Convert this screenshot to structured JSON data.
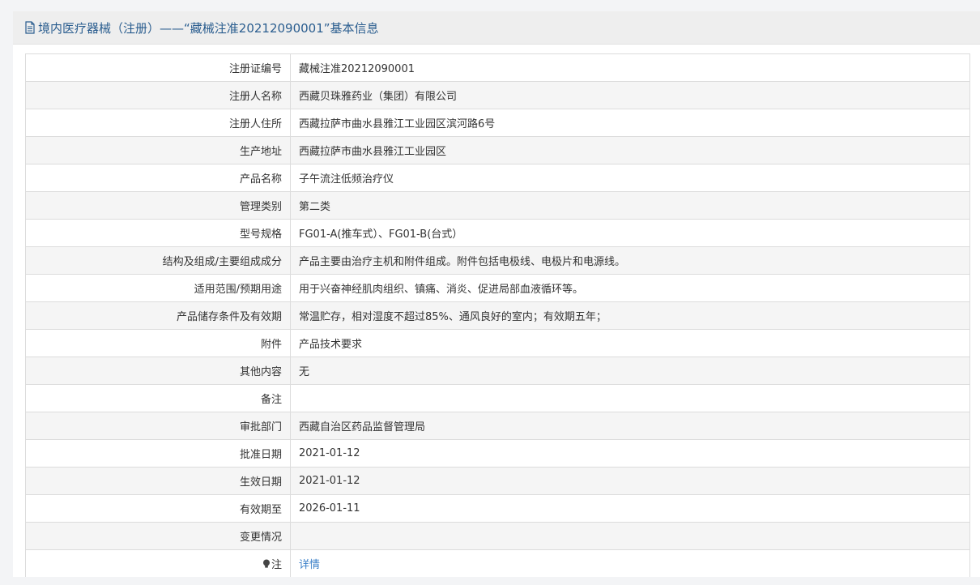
{
  "header": {
    "title": "境内医疗器械（注册）——“藏械注准20212090001”基本信息"
  },
  "rows": [
    {
      "label": "注册证编号",
      "value": "藏械注准20212090001"
    },
    {
      "label": "注册人名称",
      "value": "西藏贝珠雅药业（集团）有限公司"
    },
    {
      "label": "注册人住所",
      "value": "西藏拉萨市曲水县雅江工业园区滨河路6号"
    },
    {
      "label": "生产地址",
      "value": "西藏拉萨市曲水县雅江工业园区"
    },
    {
      "label": "产品名称",
      "value": "子午流注低频治疗仪"
    },
    {
      "label": "管理类别",
      "value": "第二类"
    },
    {
      "label": "型号规格",
      "value": "FG01-A(推车式）、FG01-B(台式）"
    },
    {
      "label": "结构及组成/主要组成成分",
      "value": "产品主要由治疗主机和附件组成。附件包括电极线、电极片和电源线。"
    },
    {
      "label": "适用范围/预期用途",
      "value": "用于兴奋神经肌肉组织、镇痛、消炎、促进局部血液循环等。"
    },
    {
      "label": "产品储存条件及有效期",
      "value": "常温贮存，相对湿度不超过85%、通风良好的室内；有效期五年；"
    },
    {
      "label": "附件",
      "value": "产品技术要求"
    },
    {
      "label": "其他内容",
      "value": "无"
    },
    {
      "label": "备注",
      "value": ""
    },
    {
      "label": "审批部门",
      "value": "西藏自治区药品监督管理局"
    },
    {
      "label": "批准日期",
      "value": "2021-01-12"
    },
    {
      "label": "生效日期",
      "value": "2021-01-12"
    },
    {
      "label": "有效期至",
      "value": "2026-01-11"
    },
    {
      "label": "变更情况",
      "value": ""
    }
  ],
  "note_row": {
    "label": "注",
    "value": "详情"
  },
  "colors": {
    "header_text": "#2a5d8f",
    "link": "#3a7fc8",
    "border": "#dcdcdc",
    "stripe": "#f5f5f5"
  }
}
